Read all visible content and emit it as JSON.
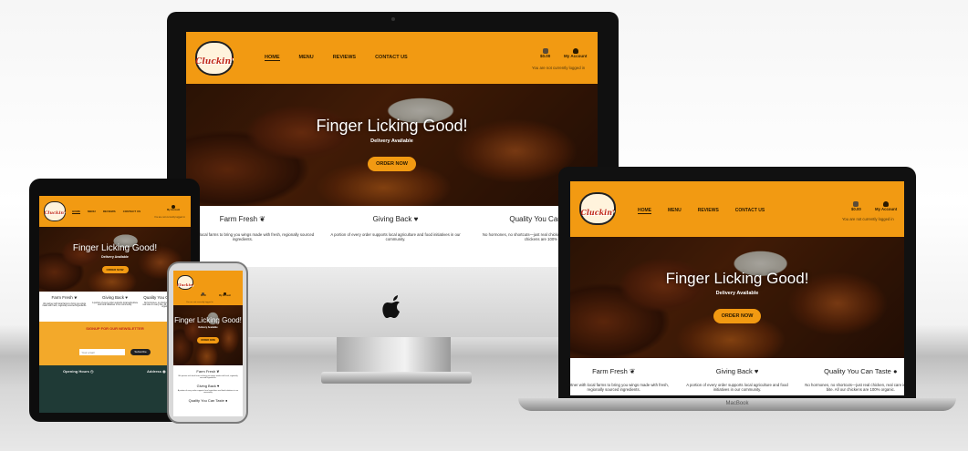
{
  "site": {
    "logo_text": "Cluckin'",
    "nav": [
      "HOME",
      "MENU",
      "REVIEWS",
      "CONTACT US"
    ],
    "account": {
      "cart": "$0.00",
      "my_account": "My Account",
      "status": "You are not currently logged in"
    },
    "hero": {
      "title": "Finger Licking Good!",
      "subtitle": "Delivery Available",
      "button": "ORDER NOW"
    },
    "features": [
      {
        "title": "Farm Fresh",
        "icon": "seedling-icon",
        "text": "We partner with local farms to bring you wings made with fresh, regionally sourced ingredients."
      },
      {
        "title": "Giving Back",
        "icon": "hand-heart-icon",
        "text": "A portion of every order supports local agriculture and food initiatives in our community."
      },
      {
        "title": "Quality You Can Taste",
        "icon": "egg-icon",
        "text": "No hormones, no shortcuts—just real chicken, real care in every bite. All our chickens are 100% organic."
      }
    ],
    "newsletter": {
      "title": "SIGNUP FOR OUR NEWSLETTER",
      "placeholder": "Your email",
      "button": "Subscribe"
    },
    "footer": {
      "hours_title": "Opening Hours",
      "address_title": "Address"
    }
  },
  "laptop_label": "MacBook",
  "colors": {
    "brand_orange": "#f29a12",
    "footer_green": "#1f3a36"
  }
}
